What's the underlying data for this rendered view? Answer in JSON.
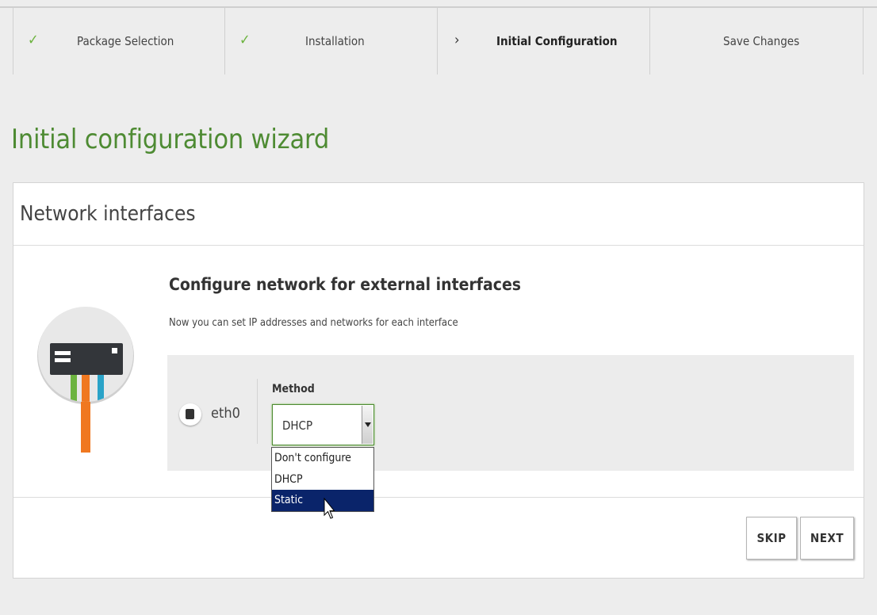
{
  "wizard_steps": [
    {
      "label": "Package Selection",
      "state": "done",
      "icon": "check-icon"
    },
    {
      "label": "Installation",
      "state": "done",
      "icon": "check-icon"
    },
    {
      "label": "Initial Configuration",
      "state": "active",
      "icon": "chevron-right-icon"
    },
    {
      "label": "Save Changes",
      "state": "pending",
      "icon": ""
    }
  ],
  "page_title": "Initial configuration wizard",
  "panel": {
    "heading": "Network interfaces",
    "section_title": "Configure network for external interfaces",
    "section_desc": "Now you can set IP addresses and networks for each interface",
    "interface": {
      "name": "eth0",
      "method_label": "Method",
      "method_value": "DHCP",
      "options": [
        "Don't configure",
        "DHCP",
        "Static"
      ],
      "highlighted_option": "Static"
    },
    "buttons": {
      "skip": "SKIP",
      "next": "NEXT"
    }
  },
  "colors": {
    "accent_green": "#4e8b33",
    "check_green": "#6cb33f",
    "selected_option_bg": "#0a246a",
    "page_bg": "#ededed"
  }
}
